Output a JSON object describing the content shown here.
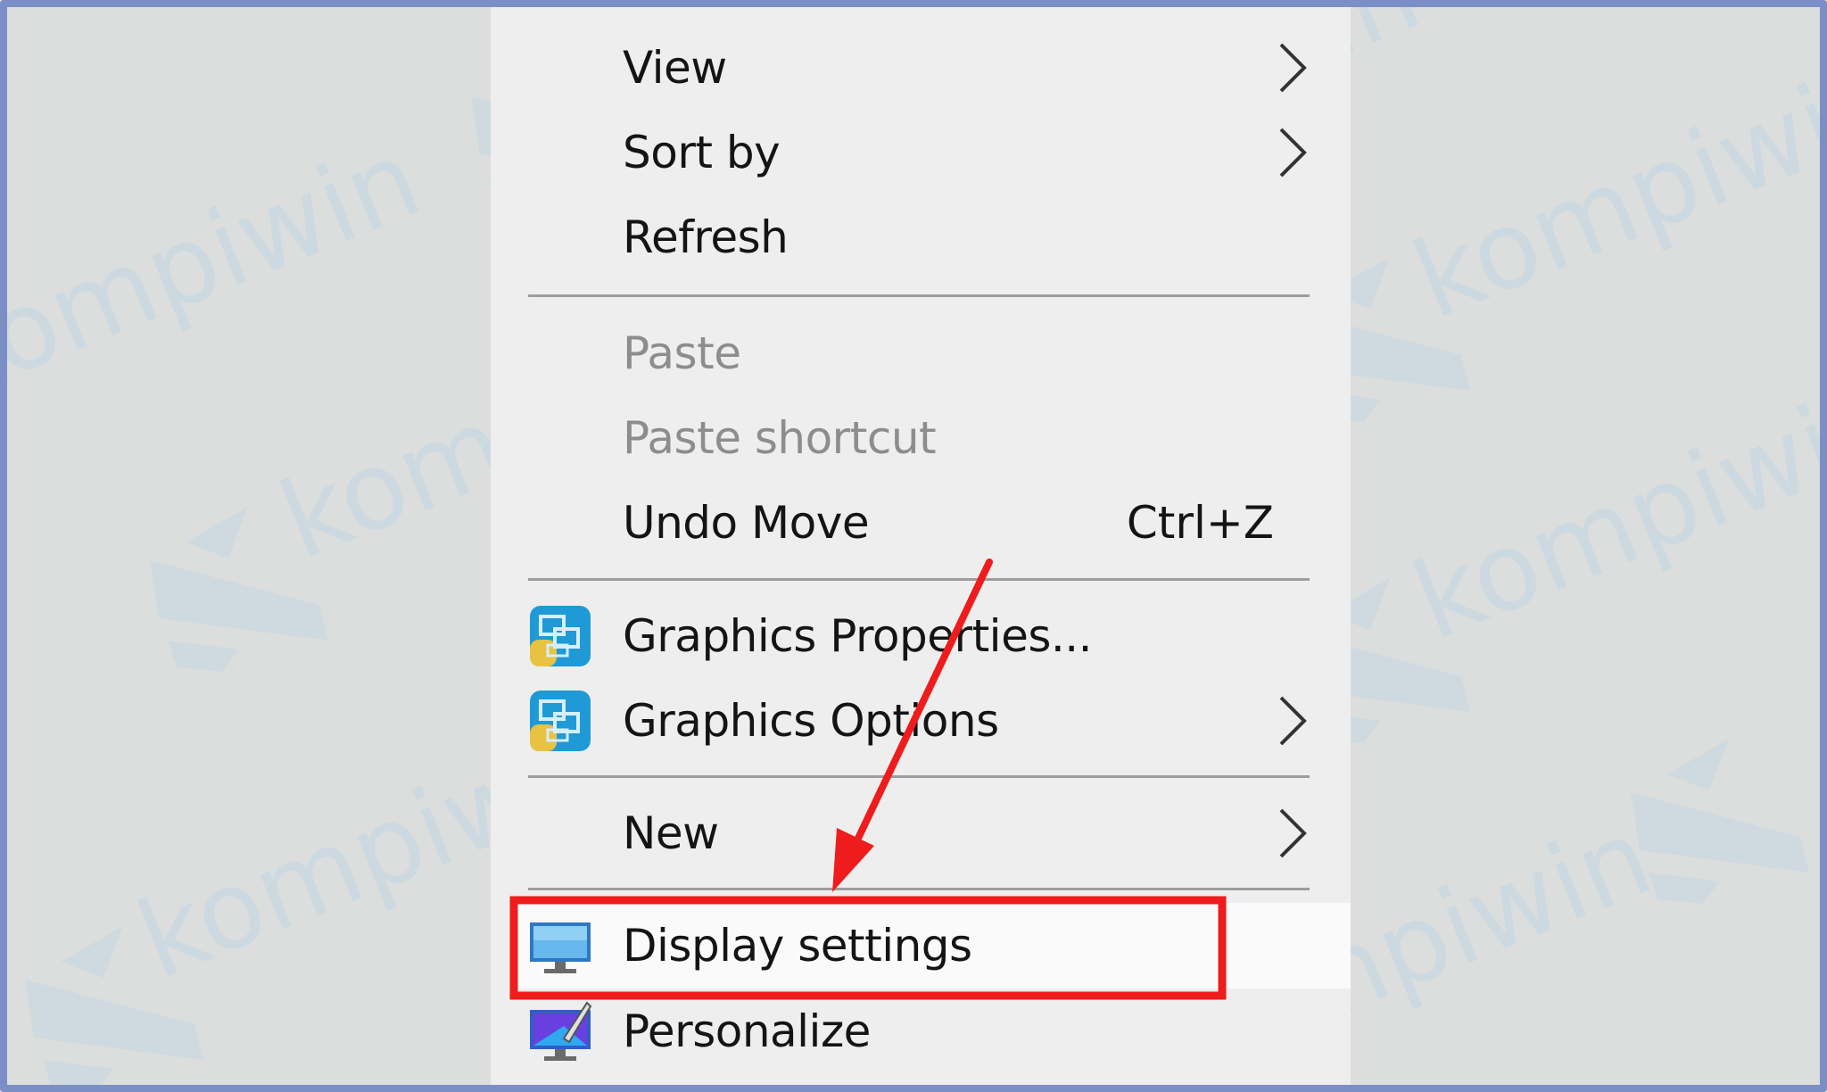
{
  "menu": {
    "items": [
      {
        "label": "View",
        "has_submenu": true,
        "disabled": false
      },
      {
        "label": "Sort by",
        "has_submenu": true,
        "disabled": false
      },
      {
        "label": "Refresh",
        "has_submenu": false,
        "disabled": false
      },
      {
        "label": "Paste",
        "has_submenu": false,
        "disabled": true
      },
      {
        "label": "Paste shortcut",
        "has_submenu": false,
        "disabled": true
      },
      {
        "label": "Undo Move",
        "shortcut": "Ctrl+Z",
        "has_submenu": false,
        "disabled": false
      },
      {
        "label": "Graphics Properties...",
        "icon": "graphics-properties-icon",
        "has_submenu": false,
        "disabled": false
      },
      {
        "label": "Graphics Options",
        "icon": "graphics-options-icon",
        "has_submenu": true,
        "disabled": false
      },
      {
        "label": "New",
        "has_submenu": true,
        "disabled": false
      },
      {
        "label": "Display settings",
        "icon": "display-monitor-icon",
        "has_submenu": false,
        "disabled": false,
        "highlighted": true
      },
      {
        "label": "Personalize",
        "icon": "personalize-icon",
        "has_submenu": false,
        "disabled": false
      }
    ]
  },
  "watermark": {
    "text": "kompiwin"
  },
  "colors": {
    "menu_background": "#eeeeee",
    "desktop_background": "#dcdedd",
    "frame_border": "#7b8fc6",
    "highlight_box": "#ee1c1c",
    "arrow": "#ee1c1c",
    "disabled_text": "#8d8d8d",
    "separator": "#9d9d9d"
  }
}
